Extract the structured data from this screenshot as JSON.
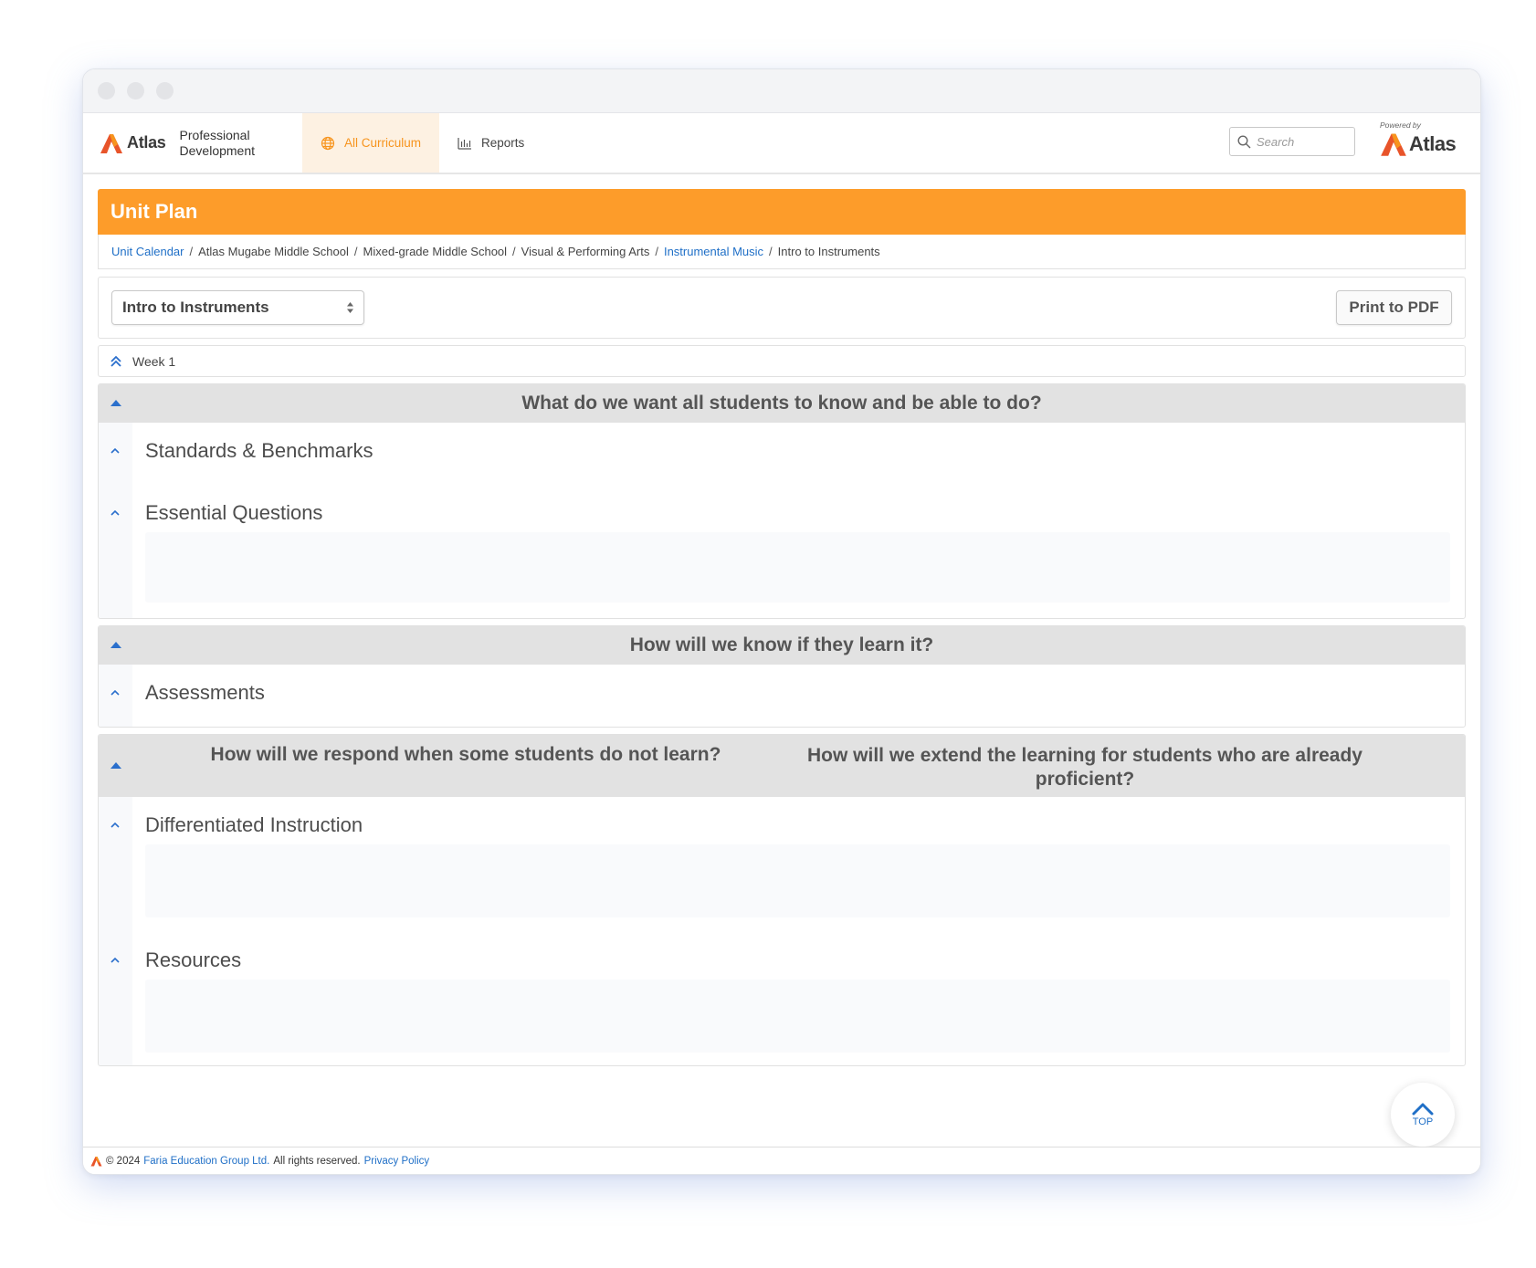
{
  "app": {
    "brand": "Atlas",
    "brand_sub_line1": "Professional",
    "brand_sub_line2": "Development",
    "nav": [
      {
        "label": "All Curriculum",
        "active": true,
        "icon": "globe-icon"
      },
      {
        "label": "Reports",
        "active": false,
        "icon": "bar-chart-icon"
      }
    ],
    "search_placeholder": "Search",
    "powered_by": "Powered by",
    "powered_brand": "Atlas"
  },
  "page": {
    "title": "Unit Plan",
    "breadcrumb": [
      {
        "label": "Unit Calendar",
        "link": true
      },
      {
        "label": "Atlas Mugabe Middle School",
        "link": false
      },
      {
        "label": "Mixed-grade Middle School",
        "link": false
      },
      {
        "label": "Visual & Performing Arts",
        "link": false
      },
      {
        "label": "Instrumental Music",
        "link": true
      },
      {
        "label": "Intro to Instruments",
        "link": false
      }
    ],
    "unit_select_value": "Intro to Instruments",
    "print_label": "Print to PDF",
    "week_label": "Week 1"
  },
  "blocks": {
    "know": {
      "heading": "What do we want all students to know and be able to do?",
      "sections": [
        "Standards & Benchmarks",
        "Essential Questions"
      ]
    },
    "learn": {
      "heading": "How will we know if they learn it?",
      "sections": [
        "Assessments"
      ]
    },
    "respond": {
      "heading_left": "How will we respond when some students do not learn?",
      "heading_right": "How will we extend the learning for students who are already proficient?",
      "sections": [
        "Differentiated Instruction",
        "Resources"
      ]
    }
  },
  "top_button": "TOP",
  "footer": {
    "copyright": "© 2024",
    "company": "Faria Education Group Ltd.",
    "rights": "All rights reserved.",
    "privacy": "Privacy Policy"
  },
  "colors": {
    "accent_orange": "#fd9c2a",
    "link_blue": "#1f6fc7",
    "section_header_gray": "#e2e2e2"
  }
}
